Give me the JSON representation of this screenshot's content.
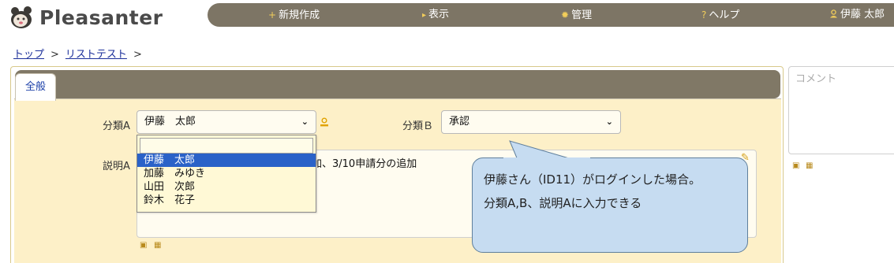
{
  "app": {
    "logo_text": "Pleasanter"
  },
  "nav": {
    "new": {
      "icon": "+",
      "label": "新規作成"
    },
    "view": {
      "icon": "▸",
      "label": "表示"
    },
    "admin": {
      "icon": "✹",
      "label": "管理"
    },
    "help": {
      "icon": "?",
      "label": "ヘルプ"
    },
    "user": {
      "icon": "person-icon",
      "label": "伊藤 太郎"
    }
  },
  "breadcrumb": {
    "items": [
      "トップ",
      "リストテスト"
    ],
    "separator": ">"
  },
  "tabs": {
    "general": "全般"
  },
  "form": {
    "class_a_label": "分類A",
    "class_a_value": "伊藤　太郎",
    "class_b_label": "分類Ｂ",
    "class_b_value": "承認",
    "desc_label": "説明A",
    "desc_value": "追加、3/10申請分の追加"
  },
  "dropdown": {
    "options": [
      "",
      "伊藤　太郎",
      "加藤　みゆき",
      "山田　次郎",
      "鈴木　花子"
    ],
    "selected_index": 1
  },
  "comment": {
    "placeholder": "コメント"
  },
  "callout": {
    "line1": "伊藤さん（ID11）がログインした場合。",
    "line2": "分類A,B、説明Aに入力できる"
  },
  "colors": {
    "navbar": "#7d7565",
    "panel": "#fdf0c8",
    "selection": "#2a62c8",
    "callout": "#c6dcf1",
    "accent_icon": "#f1cd5a"
  }
}
